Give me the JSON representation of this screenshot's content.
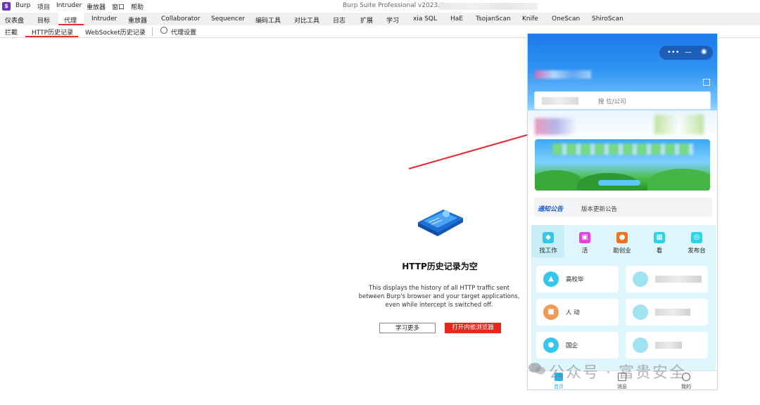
{
  "window": {
    "title": "Burp Suite Professional v2023.4",
    "app_icon": "burp-logo-icon"
  },
  "menubar": [
    {
      "label": "Burp"
    },
    {
      "label": "项目"
    },
    {
      "label": "Intruder"
    },
    {
      "label": "重放器"
    },
    {
      "label": "窗口"
    },
    {
      "label": "帮助"
    }
  ],
  "main_tabs": [
    {
      "label": "仪表盘"
    },
    {
      "label": "目标"
    },
    {
      "label": "代理",
      "active": true
    },
    {
      "label": "Intruder"
    },
    {
      "label": "重放器"
    },
    {
      "label": "Collaborator"
    },
    {
      "label": "Sequencer"
    },
    {
      "label": "编码工具"
    },
    {
      "label": "对比工具"
    },
    {
      "label": "日志"
    },
    {
      "label": "扩展"
    },
    {
      "label": "学习"
    },
    {
      "label": "xia SQL"
    },
    {
      "label": "HaE"
    },
    {
      "label": "TsojanScan"
    },
    {
      "label": "Knife"
    },
    {
      "label": "OneScan"
    },
    {
      "label": "ShiroScan"
    }
  ],
  "sub_tabs": [
    {
      "label": "拦截"
    },
    {
      "label": "HTTP历史记录",
      "active": true
    },
    {
      "label": "WebSocket历史记录"
    },
    {
      "label": "代理设置",
      "icon": "gear-icon"
    }
  ],
  "empty_state": {
    "icon": "empty-history-icon",
    "title": "HTTP历史记录为空",
    "description": "This displays the history of all HTTP traffic sent between Burp's browser and your target applications, even while intercept is switched off.",
    "learn_more_label": "学习更多",
    "open_browser_label": "打开内嵌浏览器"
  },
  "annotation": {
    "color": "#e8262b"
  },
  "phone": {
    "search_placeholder": "搜      位/公司",
    "notice_tag": "通知公告",
    "notice_text": "版本更新公告",
    "categories": [
      {
        "label": "找工作",
        "icon": "briefcase-icon",
        "color": "#36c6ec"
      },
      {
        "label": "    活",
        "icon": "chat-icon",
        "color": "#e93fe0"
      },
      {
        "label": "助创业",
        "icon": "rocket-icon",
        "color": "#f2711c"
      },
      {
        "label": "看     ",
        "icon": "calendar-icon",
        "color": "#2ad4e8"
      },
      {
        "label": "发布台",
        "icon": "send-icon",
        "color": "#2ad4e8"
      }
    ],
    "cards": [
      {
        "text": "高校毕    ",
        "icon": "graduate-icon"
      },
      {
        "text": "",
        "icon": "blurred-icon"
      },
      {
        "text": "人     动     ",
        "icon": "worker-icon"
      },
      {
        "text": "",
        "icon": "blurred-icon"
      },
      {
        "text": "国企      ",
        "icon": "person-icon"
      },
      {
        "text": "",
        "icon": "blurred-icon"
      }
    ],
    "tabbar": [
      {
        "label": "首页",
        "icon": "home-icon",
        "active": true
      },
      {
        "label": "消息",
        "icon": "message-icon"
      },
      {
        "label": "我的",
        "icon": "user-icon"
      }
    ]
  },
  "watermark": "公众号 · 富贵安全",
  "colors": {
    "accent": "#e0322c",
    "primary_button": "#e8261a",
    "phone_header": "#2f92f2",
    "notice_tag": "#1e5bd8"
  }
}
